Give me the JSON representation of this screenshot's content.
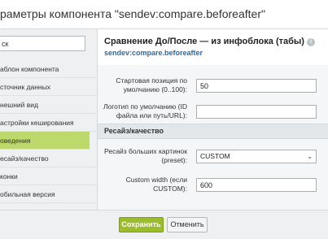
{
  "dialog": {
    "title": "раметры компонента \"sendev:compare.beforeafter\""
  },
  "sidebar": {
    "search": {
      "value": "ск"
    },
    "items": [
      {
        "label": "аблон компонента",
        "active": false
      },
      {
        "label": "сточник данных",
        "active": false
      },
      {
        "label": "нешний вид",
        "active": false
      },
      {
        "label": "астройки кеширования",
        "active": false
      },
      {
        "label": "оведения",
        "active": true
      },
      {
        "label": "есайз/качество",
        "active": false
      },
      {
        "label": "конки",
        "active": false
      },
      {
        "label": "обильная версия",
        "active": false
      }
    ]
  },
  "panel": {
    "heading": "Сравнение До/После — из инфоблока (табы)",
    "code": "sendev:compare.beforeafter",
    "info_icon": "i"
  },
  "form": {
    "start_position": {
      "label": "Стартовая позиция по умолчанию (0..100):",
      "value": "50"
    },
    "logo": {
      "label": "Логотип по умолчанию (ID файла или путь/URL):",
      "value": ""
    },
    "resize_section": "Ресайз/качество",
    "resize_large": {
      "label": "Ресайз больших картинок (preset):",
      "value": "CUSTOM"
    },
    "custom_width": {
      "label": "Custom width (если CUSTOM):",
      "value": "600"
    }
  },
  "footer": {
    "save_label": "Сохранить",
    "cancel_label": "Отменить"
  },
  "colors": {
    "accent": "#9bbd2c",
    "active_nav": "#bdd86b",
    "code_link": "#2a6ba6"
  }
}
